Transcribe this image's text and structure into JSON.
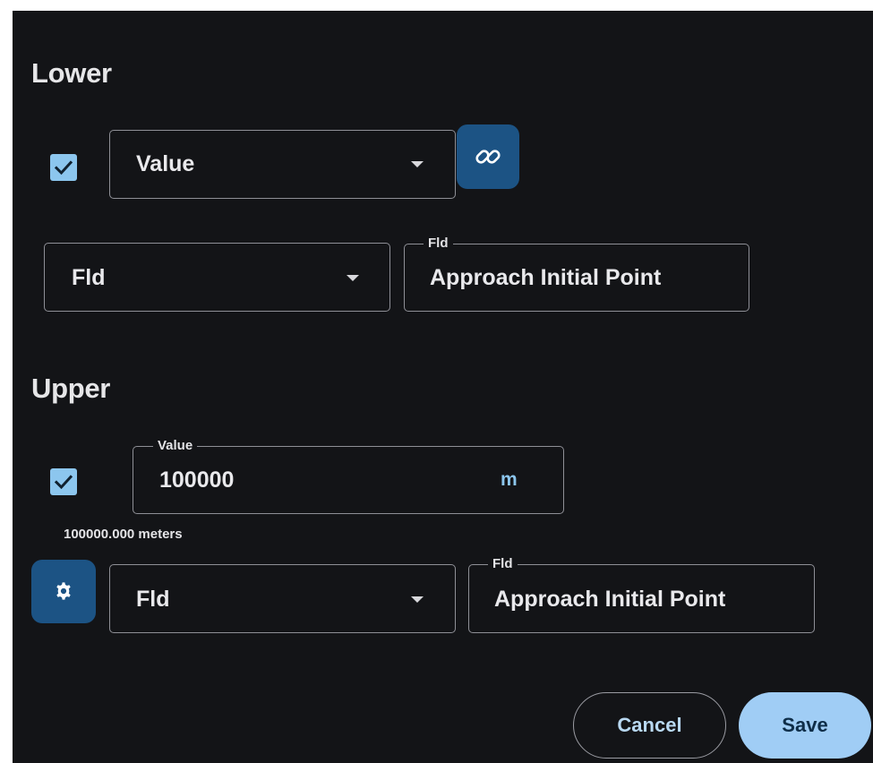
{
  "lower": {
    "heading": "Lower",
    "checkbox_checked": true,
    "type_select": {
      "value": "Value"
    },
    "link_icon": "link-icon",
    "fld_select": {
      "value": "Fld"
    },
    "fld_field": {
      "legend": "Fld",
      "value": "Approach Initial Point"
    }
  },
  "upper": {
    "heading": "Upper",
    "checkbox_checked": true,
    "value_field": {
      "legend": "Value",
      "value": "100000",
      "unit": "m"
    },
    "helper_text": "100000.000 meters",
    "settings_icon": "gear-icon",
    "fld_select": {
      "value": "Fld"
    },
    "fld_field": {
      "legend": "Fld",
      "value": "Approach Initial Point"
    }
  },
  "actions": {
    "cancel_label": "Cancel",
    "save_label": "Save"
  },
  "colors": {
    "panel_background": "#131417",
    "checkbox": "#8cc6ee",
    "icon_button": "#1c5384",
    "save_button": "#a0cdf5",
    "field_border": "#8e8f96"
  }
}
